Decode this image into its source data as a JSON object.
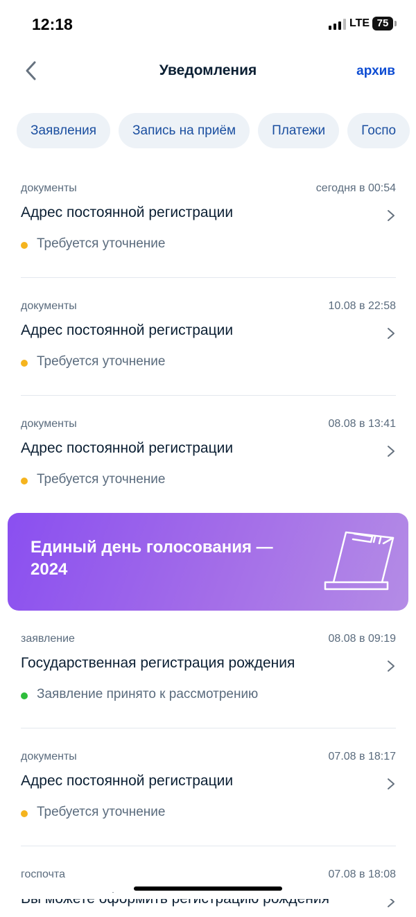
{
  "status_bar": {
    "time": "12:18",
    "network": "LTE",
    "battery": "75"
  },
  "nav": {
    "title": "Уведомления",
    "archive": "архив"
  },
  "filters": [
    "Заявления",
    "Запись на приём",
    "Платежи",
    "Госпо"
  ],
  "notifications": [
    {
      "category": "документы",
      "time": "сегодня в 00:54",
      "title": "Адрес постоянной регистрации",
      "status": "Требуется уточнение",
      "status_color": "#f5b41e"
    },
    {
      "category": "документы",
      "time": "10.08 в 22:58",
      "title": "Адрес постоянной регистрации",
      "status": "Требуется уточнение",
      "status_color": "#f5b41e"
    },
    {
      "category": "документы",
      "time": "08.08 в 13:41",
      "title": "Адрес постоянной регистрации",
      "status": "Требуется уточнение",
      "status_color": "#f5b41e"
    },
    {
      "category": "заявление",
      "time": "08.08 в 09:19",
      "title": "Государственная регистрация рождения",
      "status": "Заявление принято к рассмотрению",
      "status_color": "#2ebd3b"
    },
    {
      "category": "документы",
      "time": "07.08 в 18:17",
      "title": "Адрес постоянной регистрации",
      "status": "Требуется уточнение",
      "status_color": "#f5b41e"
    },
    {
      "category": "госпочта",
      "time": "07.08 в 18:08",
      "title": "Вы можете оформить регистрацию рождения"
    }
  ],
  "banner": {
    "text": "Единый день голосования — 2024"
  },
  "colors": {
    "accent": "#0d4cd3",
    "banner_start": "#8a4ff0",
    "banner_end": "#b48ce6"
  }
}
